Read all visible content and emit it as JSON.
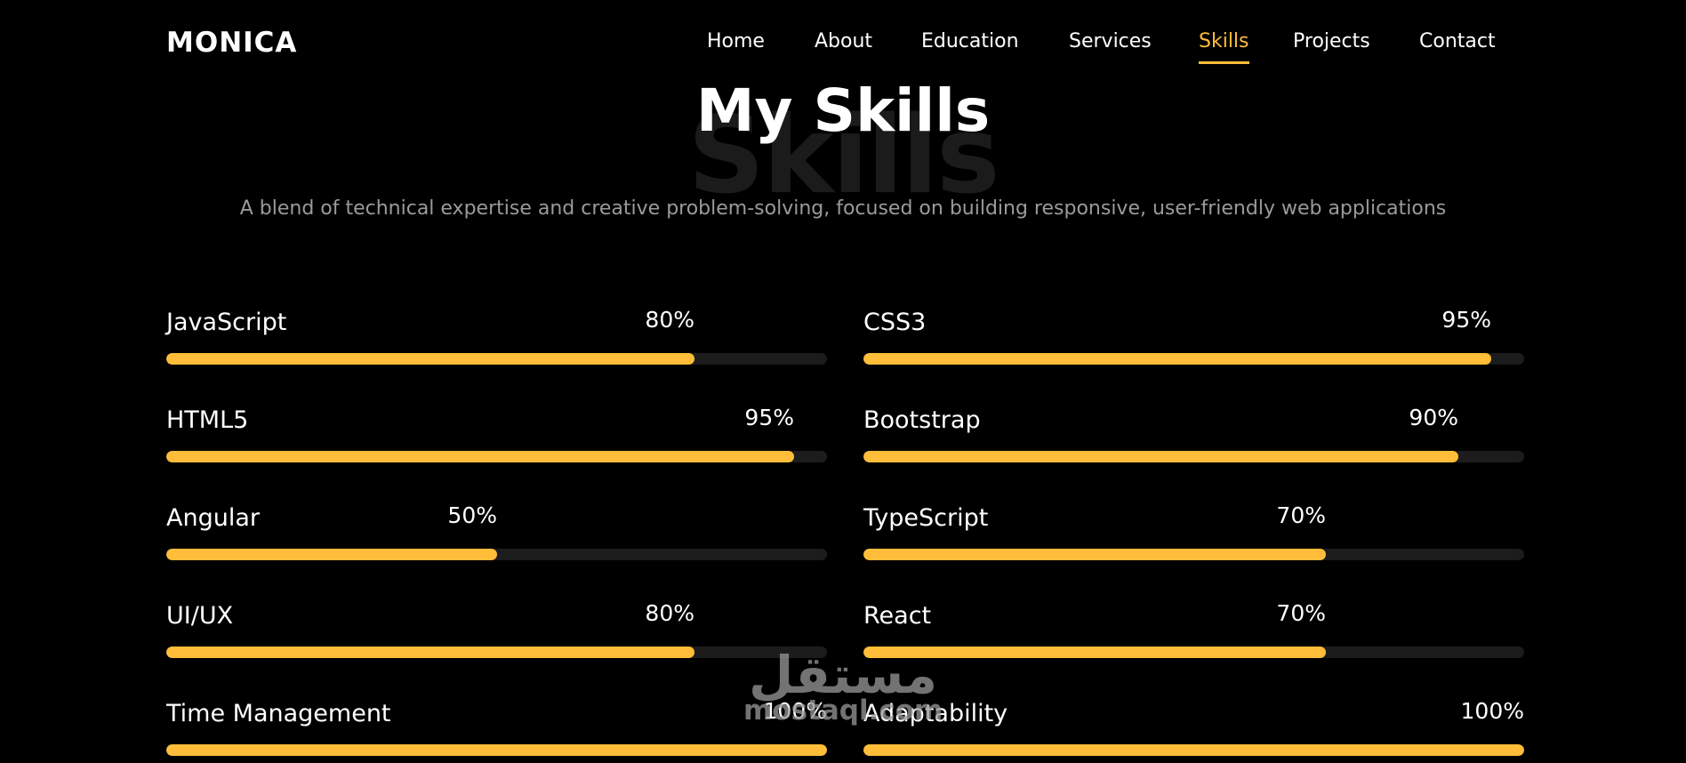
{
  "header": {
    "logo": "MONICA",
    "nav": [
      {
        "label": "Home",
        "name": "nav-home",
        "active": false
      },
      {
        "label": "About",
        "name": "nav-about",
        "active": false
      },
      {
        "label": "Education",
        "name": "nav-education",
        "active": false
      },
      {
        "label": "Services",
        "name": "nav-services",
        "active": false
      },
      {
        "label": "Skills",
        "name": "nav-skills",
        "active": true
      },
      {
        "label": "Projects",
        "name": "nav-projects",
        "active": false
      },
      {
        "label": "Contact",
        "name": "nav-contact",
        "active": false
      }
    ]
  },
  "section": {
    "background_word": "Skills",
    "title": "My Skills",
    "subtitle": "A blend of technical expertise and creative problem-solving, focused on building responsive, user-friendly web applications"
  },
  "skills": [
    {
      "name": "JavaScript",
      "percent": "80%",
      "value": 80
    },
    {
      "name": "CSS3",
      "percent": "95%",
      "value": 95
    },
    {
      "name": "HTML5",
      "percent": "95%",
      "value": 95
    },
    {
      "name": "Bootstrap",
      "percent": "90%",
      "value": 90
    },
    {
      "name": "Angular",
      "percent": "50%",
      "value": 50
    },
    {
      "name": "TypeScript",
      "percent": "70%",
      "value": 70
    },
    {
      "name": "UI/UX",
      "percent": "80%",
      "value": 80
    },
    {
      "name": "React",
      "percent": "70%",
      "value": 70
    },
    {
      "name": "Time Management",
      "percent": "100%",
      "value": 100
    },
    {
      "name": "Adaptability",
      "percent": "100%",
      "value": 100
    }
  ],
  "watermark": {
    "arabic": "مستقل",
    "latin": "mostaql.com"
  },
  "colors": {
    "accent": "#ffbd39",
    "background": "#000000",
    "track": "#1c1c1c",
    "subtitle": "#9a9a9a"
  }
}
